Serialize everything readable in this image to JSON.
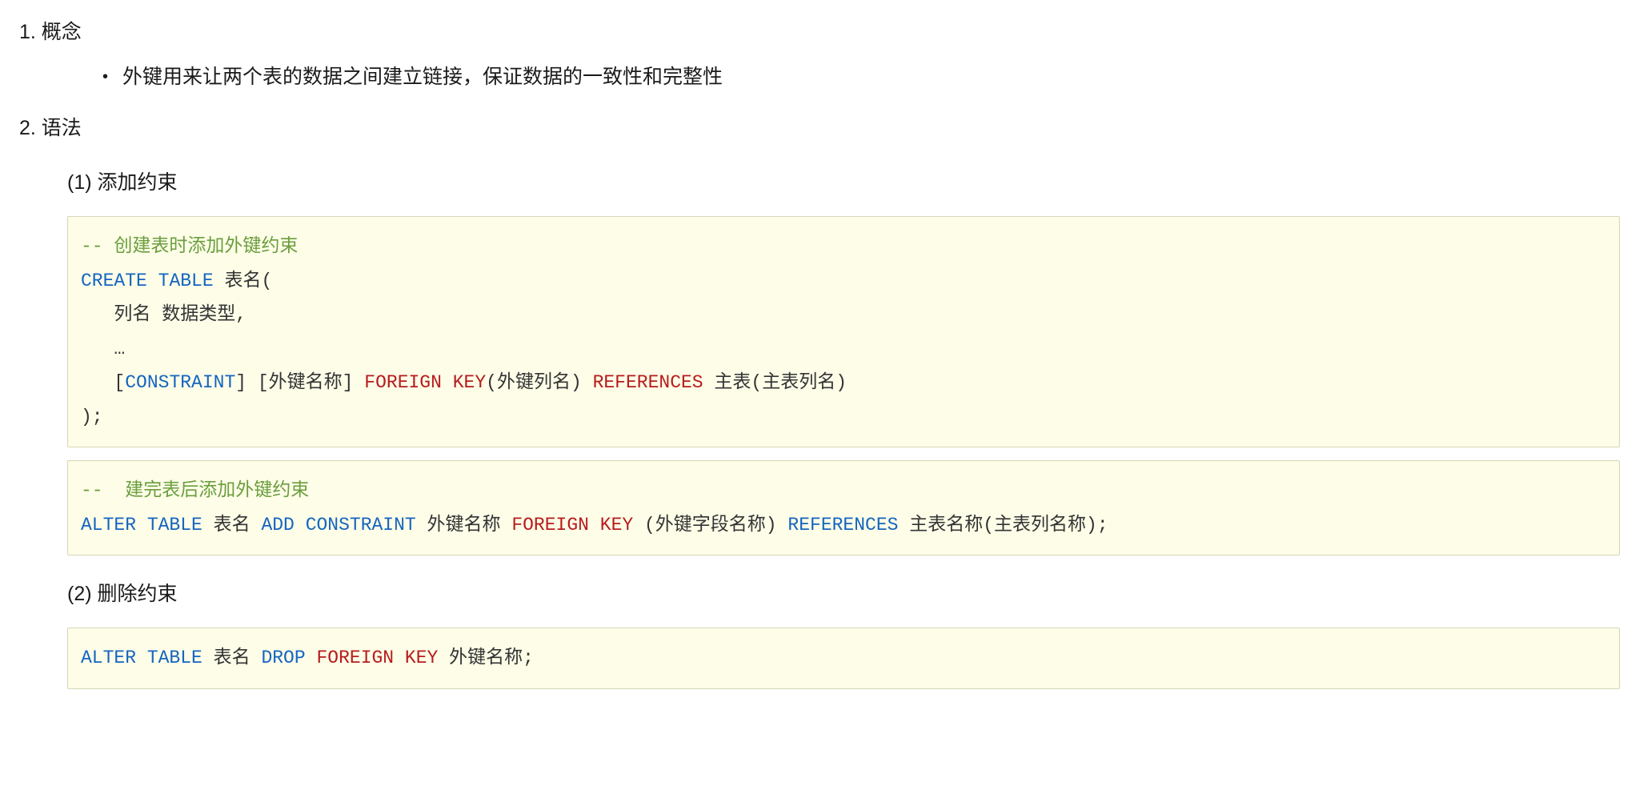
{
  "sections": {
    "concept": {
      "heading": "1. 概念",
      "bullet_text": "外键用来让两个表的数据之间建立链接，保证数据的一致性和完整性"
    },
    "syntax": {
      "heading": "2. 语法",
      "add_constraint": {
        "heading": "(1)  添加约束",
        "code1": {
          "comment_prefix": "--",
          "comment_text": " 创建表时添加外键约束",
          "kw_create": "CREATE",
          "kw_table": "TABLE",
          "txt_tablename_open": " 表名(",
          "indent": "   ",
          "txt_col_line": "列名 数据类型,",
          "txt_ellipsis": "…",
          "txt_constraint_open": "[",
          "kw_constraint": "CONSTRAINT",
          "txt_constraint_close": "]",
          "txt_fkname": " [外键名称] ",
          "kw_foreign": "FOREIGN",
          "kw_key": "KEY",
          "txt_fkcol": "(外键列名) ",
          "kw_references": "REFERENCES",
          "txt_maintable": " 主表(主表列名)",
          "txt_close": ");"
        },
        "code2": {
          "comment_prefix": "--",
          "comment_text": "  建完表后添加外键约束",
          "kw_alter": "ALTER",
          "kw_table": "TABLE",
          "txt_tablename": " 表名 ",
          "kw_add": "ADD",
          "kw_constraint": "CONSTRAINT",
          "txt_fkname": " 外键名称 ",
          "kw_foreign": "FOREIGN",
          "kw_key": "KEY",
          "txt_fkcol": " (外键字段名称) ",
          "kw_references": "REFERENCES",
          "txt_maintable": " 主表名称(主表列名称);"
        }
      },
      "drop_constraint": {
        "heading": "(2)  删除约束",
        "code": {
          "kw_alter": "ALTER",
          "kw_table": "TABLE",
          "txt_tablename": " 表名 ",
          "kw_drop": "DROP",
          "kw_foreign": "FOREIGN",
          "kw_key": "KEY",
          "txt_fkname": " 外键名称;"
        }
      }
    }
  }
}
